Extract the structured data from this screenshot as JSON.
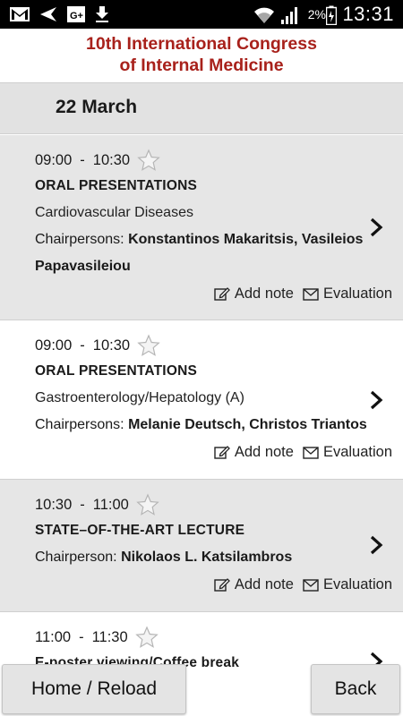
{
  "status_bar": {
    "battery_percent": "2%",
    "time": "13:31",
    "icons": [
      "gmail-icon",
      "send-icon",
      "google-plus-icon",
      "download-icon",
      "wifi-icon",
      "signal-icon",
      "battery-icon"
    ]
  },
  "header": {
    "title_line1": "10th International Congress",
    "title_line2": "of Internal Medicine",
    "title_color": "#a8211b"
  },
  "day": {
    "label": "22 March"
  },
  "sessions": [
    {
      "start": "09:00",
      "end": "10:30",
      "dash": "-",
      "title": "ORAL PRESENTATIONS",
      "topic": "Cardiovascular Diseases",
      "chair_label": "Chairpersons:",
      "chair_names": "Konstantinos Makaritsis, Vasileios Papavasileiou",
      "add_note": "Add note",
      "evaluation": "Evaluation"
    },
    {
      "start": "09:00",
      "end": "10:30",
      "dash": "-",
      "title": "ORAL PRESENTATIONS",
      "topic": "Gastroenterology/Hepatology (A)",
      "chair_label": "Chairpersons:",
      "chair_names": "Melanie Deutsch, Christos Triantos",
      "add_note": "Add note",
      "evaluation": "Evaluation"
    },
    {
      "start": "10:30",
      "end": "11:00",
      "dash": "-",
      "title": "STATE–OF-THE-ART LECTURE",
      "chair_label": "Chairperson:",
      "chair_names": "Nikolaos L. Katsilambros",
      "add_note": "Add note",
      "evaluation": "Evaluation"
    },
    {
      "start": "11:00",
      "end": "11:30",
      "dash": "-",
      "title": "E-poster viewing/Coffee break"
    }
  ],
  "footer": {
    "home_label": "Home / Reload",
    "back_label": "Back"
  }
}
